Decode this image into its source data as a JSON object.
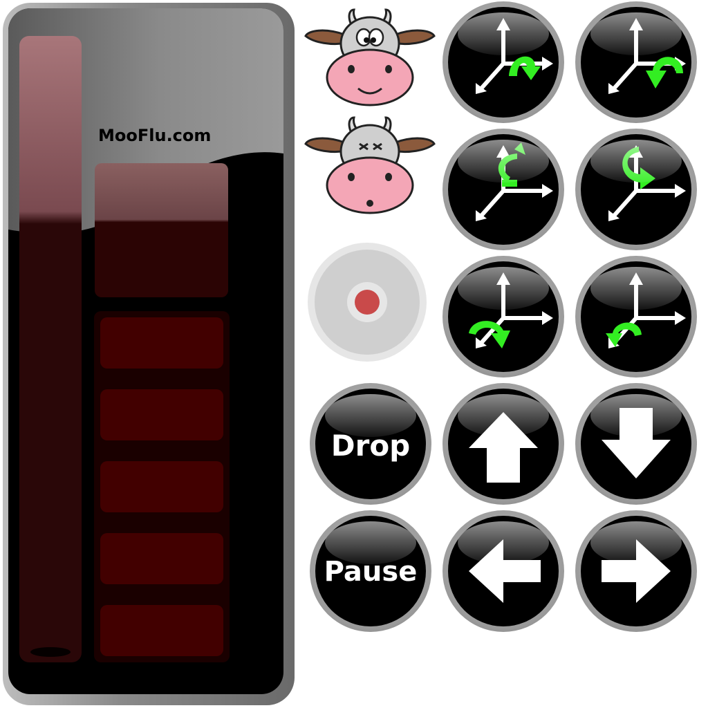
{
  "device": {
    "brand": "MooFlu.com",
    "score_rows": 5
  },
  "colors": {
    "cow_nose": "#f4a6b6",
    "arrow_green": "#33ee22",
    "record_dot": "#c94a4a",
    "panel_red": "#420000"
  },
  "cows": [
    {
      "name": "cow-happy-icon",
      "expression": "happy"
    },
    {
      "name": "cow-dizzy-icon",
      "expression": "dizzy"
    }
  ],
  "buttons": {
    "drop_label": "Drop",
    "pause_label": "Pause",
    "icons": {
      "rotate_1": "rotate-axis-icon",
      "rotate_2": "rotate-axis-icon",
      "rotate_3": "rotate-axis-icon",
      "rotate_4": "rotate-axis-icon",
      "rotate_5": "rotate-axis-icon",
      "rotate_6": "rotate-axis-icon",
      "up": "arrow-up-icon",
      "down": "arrow-down-icon",
      "left": "arrow-left-icon",
      "right": "arrow-right-icon",
      "record": "record-icon"
    }
  }
}
